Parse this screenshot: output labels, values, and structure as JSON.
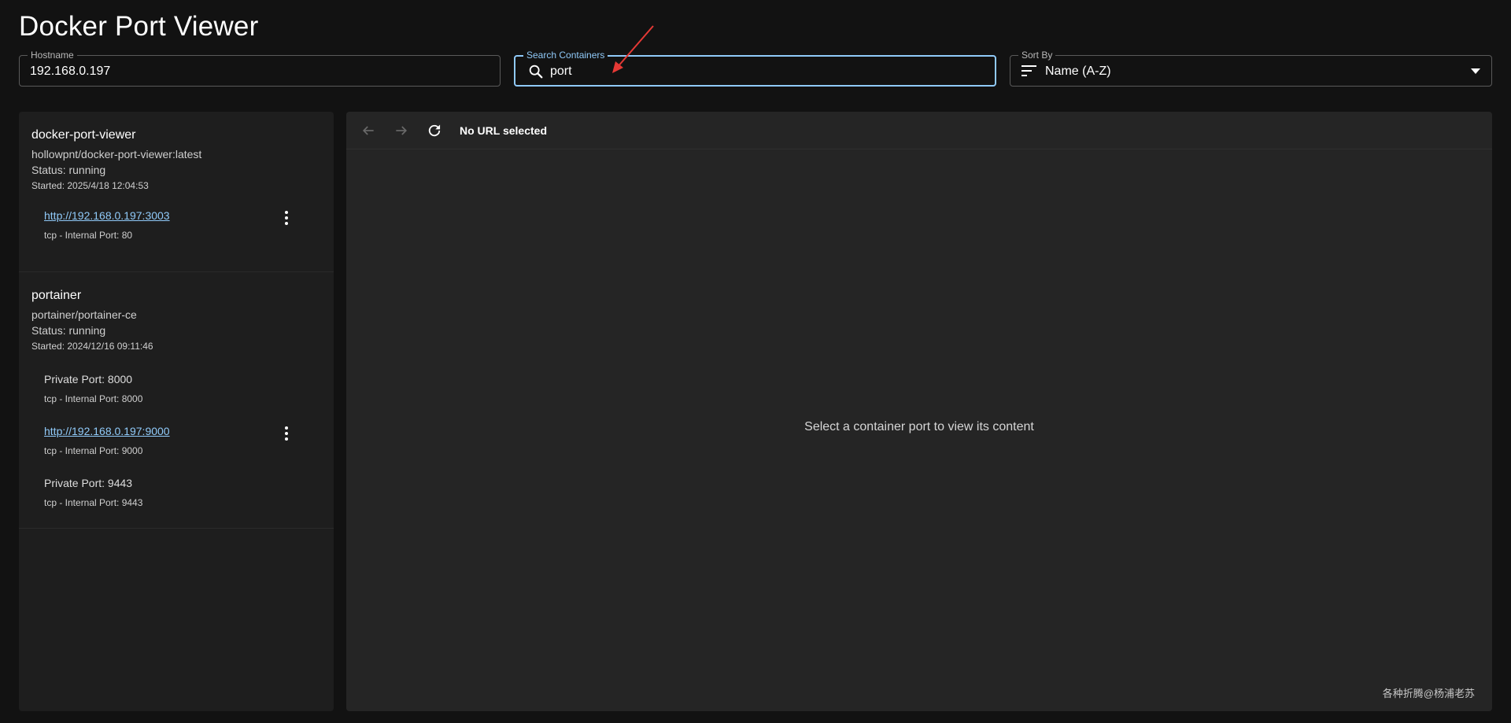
{
  "header": {
    "title": "Docker Port Viewer"
  },
  "filters": {
    "hostname": {
      "label": "Hostname",
      "value": "192.168.0.197"
    },
    "search": {
      "label": "Search Containers",
      "value": "port"
    },
    "sort": {
      "label": "Sort By",
      "value": "Name (A-Z)"
    }
  },
  "containers": [
    {
      "name": "docker-port-viewer",
      "image": "hollowpnt/docker-port-viewer:latest",
      "status": "Status: running",
      "started": "Started: 2025/4/18 12:04:53",
      "ports": [
        {
          "link": "http://192.168.0.197:3003",
          "detail": "tcp - Internal Port: 80"
        }
      ]
    },
    {
      "name": "portainer",
      "image": "portainer/portainer-ce",
      "status": "Status: running",
      "started": "Started: 2024/12/16 09:11:46",
      "ports": [
        {
          "private": "Private Port: 8000",
          "detail": "tcp - Internal Port: 8000"
        },
        {
          "link": "http://192.168.0.197:9000",
          "detail": "tcp - Internal Port: 9000"
        },
        {
          "private": "Private Port: 9443",
          "detail": "tcp - Internal Port: 9443"
        }
      ]
    }
  ],
  "viewer": {
    "url_label": "No URL selected",
    "empty_message": "Select a container port to view its content"
  },
  "watermark": "各种折腾@杨浦老苏",
  "colors": {
    "accent": "#90caf9",
    "background": "#121212",
    "panel": "#1e1e1e",
    "viewer": "#252525",
    "annotation": "#e53935"
  },
  "icons": [
    "search-icon",
    "sort-icon",
    "chevron-down-icon",
    "back-arrow-icon",
    "forward-arrow-icon",
    "refresh-icon",
    "more-vert-icon"
  ]
}
